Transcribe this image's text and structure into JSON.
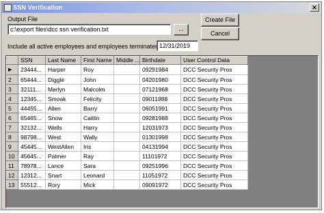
{
  "window": {
    "title": "SSN Verification",
    "close_glyph": "✕"
  },
  "output": {
    "label": "Output File",
    "path": "c:\\export files\\dcc ssn verification.txt",
    "browse_label": "..."
  },
  "buttons": {
    "create": "Create File",
    "cancel": "Cancel"
  },
  "filter": {
    "label": "Include all active employees and employees terminated after:",
    "date": "12/31/2019"
  },
  "grid": {
    "columns": [
      "SSN",
      "Last Name",
      "First Name",
      "Middle ...",
      "Birthdate",
      "User Control Data"
    ],
    "rows": [
      {
        "n": "",
        "ssn": "23444...",
        "last": "Harper",
        "first": "Roy",
        "middle": "",
        "birth": "09291984",
        "ucd": "DCC Security Pros"
      },
      {
        "n": "2",
        "ssn": "65444...",
        "last": "Diggle",
        "first": "John",
        "middle": "",
        "birth": "04201980",
        "ucd": "DCC Security Pros"
      },
      {
        "n": "3",
        "ssn": "32111...",
        "last": "Merlyn",
        "first": "Malcolm",
        "middle": "",
        "birth": "07121968",
        "ucd": "DCC Security Pros"
      },
      {
        "n": "4",
        "ssn": "12345...",
        "last": "Smoak",
        "first": "Felicity",
        "middle": "",
        "birth": "09011988",
        "ucd": "DCC Security Pros"
      },
      {
        "n": "5",
        "ssn": "44455...",
        "last": "Allen",
        "first": "Barry",
        "middle": "",
        "birth": "06051991",
        "ucd": "DCC Security Pros"
      },
      {
        "n": "6",
        "ssn": "65465...",
        "last": "Snow",
        "first": "Caitlin",
        "middle": "",
        "birth": "09281988",
        "ucd": "DCC Security Pros"
      },
      {
        "n": "7",
        "ssn": "32132...",
        "last": "Wells",
        "first": "Harry",
        "middle": "",
        "birth": "12031973",
        "ucd": "DCC Security Pros"
      },
      {
        "n": "8",
        "ssn": "98798...",
        "last": "West",
        "first": "Wally",
        "middle": "",
        "birth": "01301998",
        "ucd": "DCC Security Pros"
      },
      {
        "n": "9",
        "ssn": "45445...",
        "last": "WestAllen",
        "first": "Iris",
        "middle": "",
        "birth": "04131994",
        "ucd": "DCC Security Pros"
      },
      {
        "n": "10",
        "ssn": "45645...",
        "last": "Palmer",
        "first": "Ray",
        "middle": "",
        "birth": "11101972",
        "ucd": "DCC Security Pros"
      },
      {
        "n": "11",
        "ssn": "78978...",
        "last": "Lance",
        "first": "Sara",
        "middle": "",
        "birth": "09251996",
        "ucd": "DCC Security Pros"
      },
      {
        "n": "12",
        "ssn": "12312...",
        "last": "Snart",
        "first": "Leonard",
        "middle": "",
        "birth": "11051972",
        "ucd": "DCC Security Pros"
      },
      {
        "n": "13",
        "ssn": "55512...",
        "last": "Rory",
        "first": "Mick",
        "middle": "",
        "birth": "09091972",
        "ucd": "DCC Security Pros"
      }
    ]
  }
}
